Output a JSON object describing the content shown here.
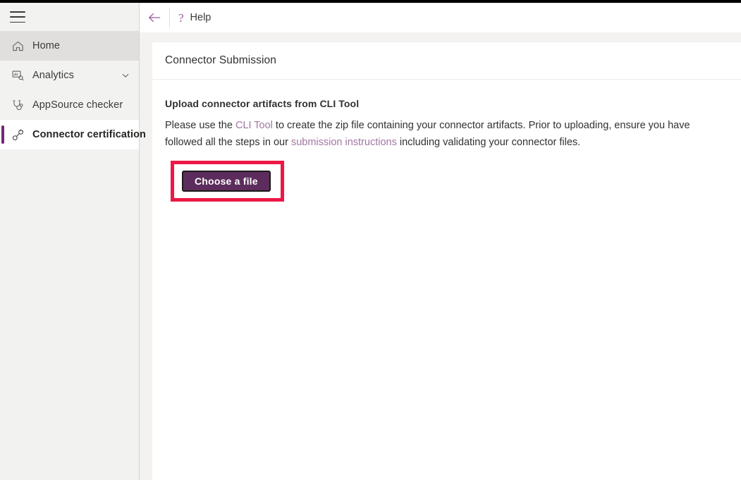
{
  "window": {
    "accent_color": "#742774",
    "highlight_color": "#ED1846",
    "button_color": "#5C2D5C",
    "link_color": "#A277A2"
  },
  "sidebar": {
    "menu_toggle_name": "hamburger-menu",
    "items": [
      {
        "label": "Home",
        "icon": "home-icon",
        "state": "hover"
      },
      {
        "label": "Analytics",
        "icon": "analytics-icon",
        "state": "default",
        "chevron": "chevron-down-icon"
      },
      {
        "label": "AppSource checker",
        "icon": "stethoscope-icon",
        "state": "default"
      },
      {
        "label": "Connector certification",
        "icon": "connector-plug-icon",
        "state": "selected"
      }
    ]
  },
  "commandbar": {
    "back_label": "back-arrow",
    "help_icon": "?",
    "help_label": "Help"
  },
  "card": {
    "title": "Connector Submission",
    "section_heading": "Upload connector artifacts from CLI Tool",
    "paragraph": {
      "part1": "Please use the ",
      "link1": "CLI Tool",
      "part2": " to create the zip file containing your connector artifacts. Prior to uploading, ensure you have followed all the steps in our ",
      "link2": "submission instructions",
      "part3": " including validating your connector files."
    },
    "choose_file_label": "Choose a file"
  }
}
